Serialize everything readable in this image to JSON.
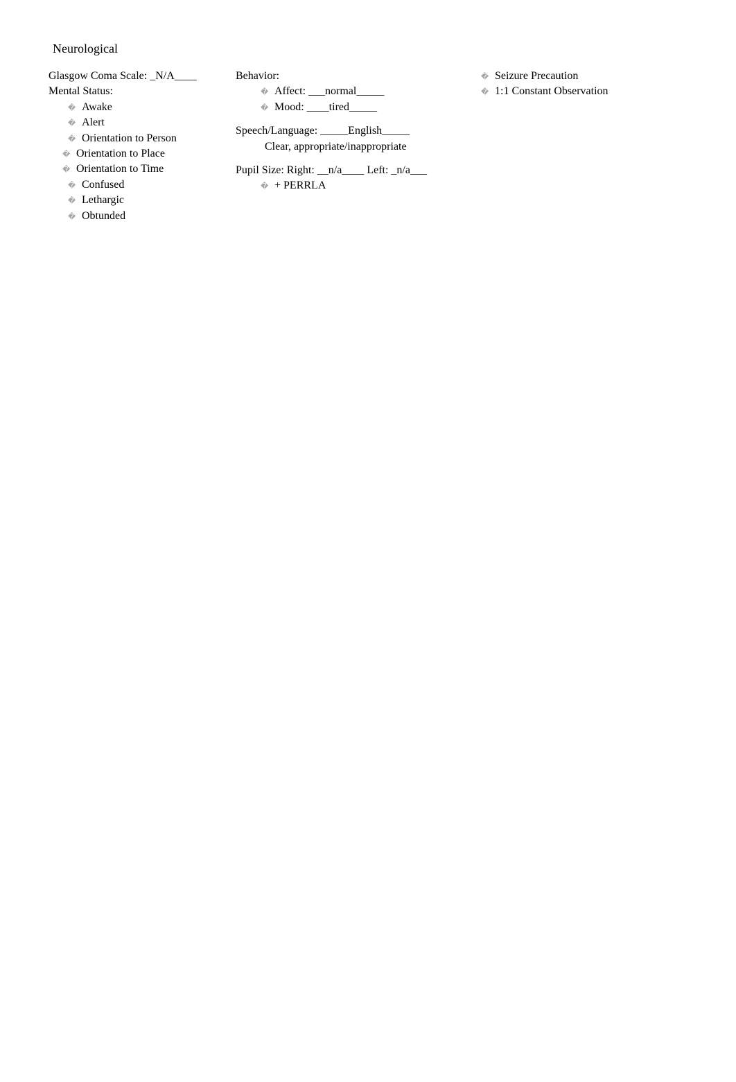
{
  "section_title": "Neurological",
  "col1": {
    "glasgow": "Glasgow Coma Scale: _N/A____",
    "mental_status_label": "Mental Status:",
    "items": {
      "awake": "Awake",
      "alert": "Alert",
      "orientation_person": "Orientation to Person",
      "orientation_place": "Orientation to Place",
      "orientation_time": "Orientation to Time",
      "confused": "Confused",
      "lethargic": "Lethargic",
      "obtunded": "Obtunded"
    }
  },
  "col2": {
    "behavior_label": "Behavior:",
    "affect": "Affect: ___normal_____",
    "mood": "Mood: ____tired_____",
    "speech_language": "Speech/Language: _____English_____",
    "speech_desc": "Clear, appropriate/inappropriate",
    "pupil_size": "Pupil Size: Right: __n/a____   Left: _n/a___",
    "perrla": "+ PERRLA"
  },
  "col3": {
    "seizure": "Seizure Precaution",
    "observation": "1:1 Constant Observation"
  },
  "bullet_glyph": "�"
}
